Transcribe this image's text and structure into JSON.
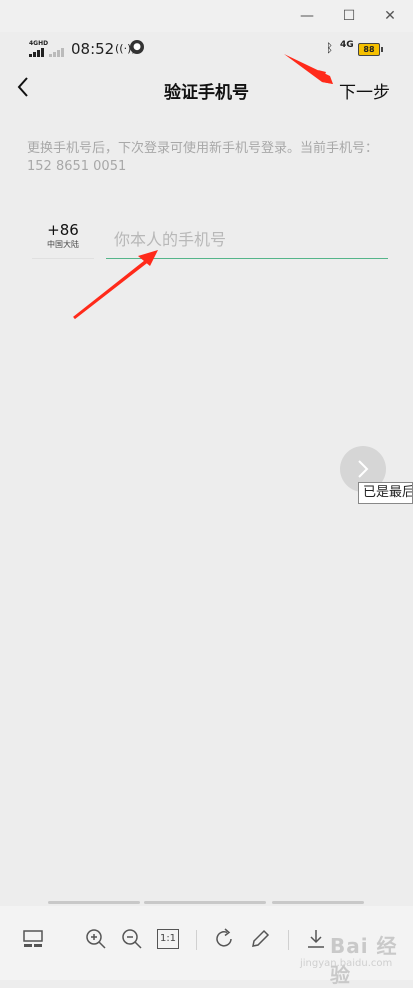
{
  "window": {
    "minimize_glyph": "—",
    "maximize_glyph": "☐",
    "close_glyph": "✕"
  },
  "status_bar": {
    "signal_label": "4GHD",
    "time": "08:52",
    "network": "4G",
    "battery": "88",
    "icons": [
      "signal-icon",
      "hotspot-icon",
      "flame-icon",
      "bluetooth-icon",
      "battery-icon"
    ]
  },
  "header": {
    "back_glyph": "<",
    "title": "验证手机号",
    "next_label": "下一步"
  },
  "hint": "更换手机号后，下次登录可使用新手机号登录。当前手机号：152 8651 0051",
  "phone": {
    "country_code": "+86",
    "region": "中国大陆",
    "placeholder": "你本人的手机号",
    "value": ""
  },
  "viewer": {
    "tooltip": "已是最后一页",
    "accent": "#55b58a",
    "arrow_color": "#ff2a1a",
    "toolbar_icons": [
      "thumbnail-icon",
      "zoom-in-icon",
      "zoom-out-icon",
      "actual-size-icon",
      "rotate-icon",
      "edit-icon",
      "download-icon"
    ],
    "actual_size_label": "1:1",
    "watermark": "Bai 经验",
    "watermark_sub": "jingyan.baidu.com"
  }
}
